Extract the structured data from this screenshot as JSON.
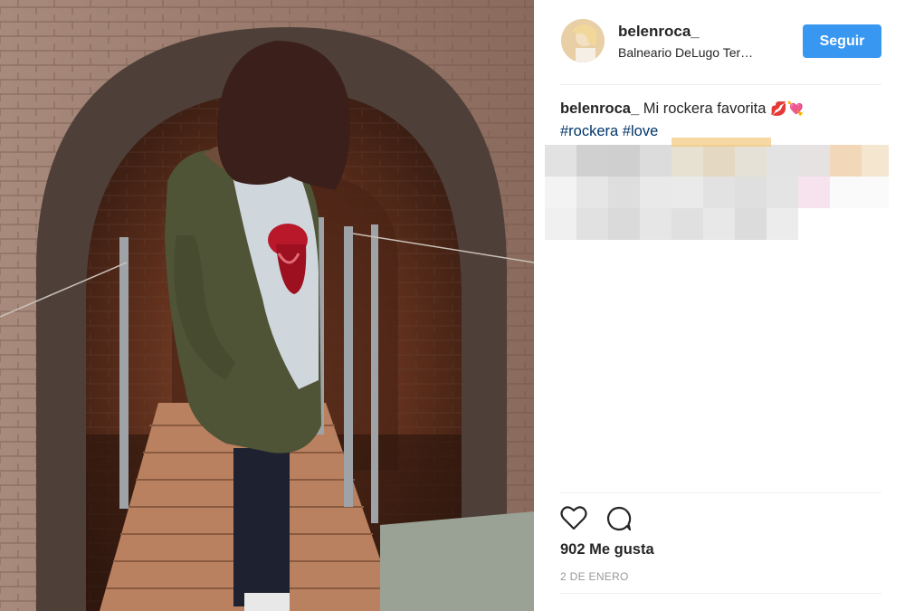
{
  "post": {
    "image_alt": "Girl with a green parka standing on a wooden walkway inside a stone vaulted ruin",
    "author": {
      "username": "belenroca_",
      "location": "Balneario DeLugo Ter…",
      "follow_label": "Seguir"
    },
    "caption": {
      "username": "belenroca_",
      "text": " Mi rockera favorita ",
      "emojis": "💋💘",
      "hashtags": [
        "#rockera",
        "#love"
      ]
    },
    "likes_label": "902 Me gusta",
    "date_label": "2 DE ENERO",
    "icons": {
      "like": "heart-icon",
      "comment": "comment-bubble-icon"
    },
    "colors": {
      "accent": "#3897f0",
      "hashtag": "#003569",
      "muted": "#999999"
    }
  }
}
